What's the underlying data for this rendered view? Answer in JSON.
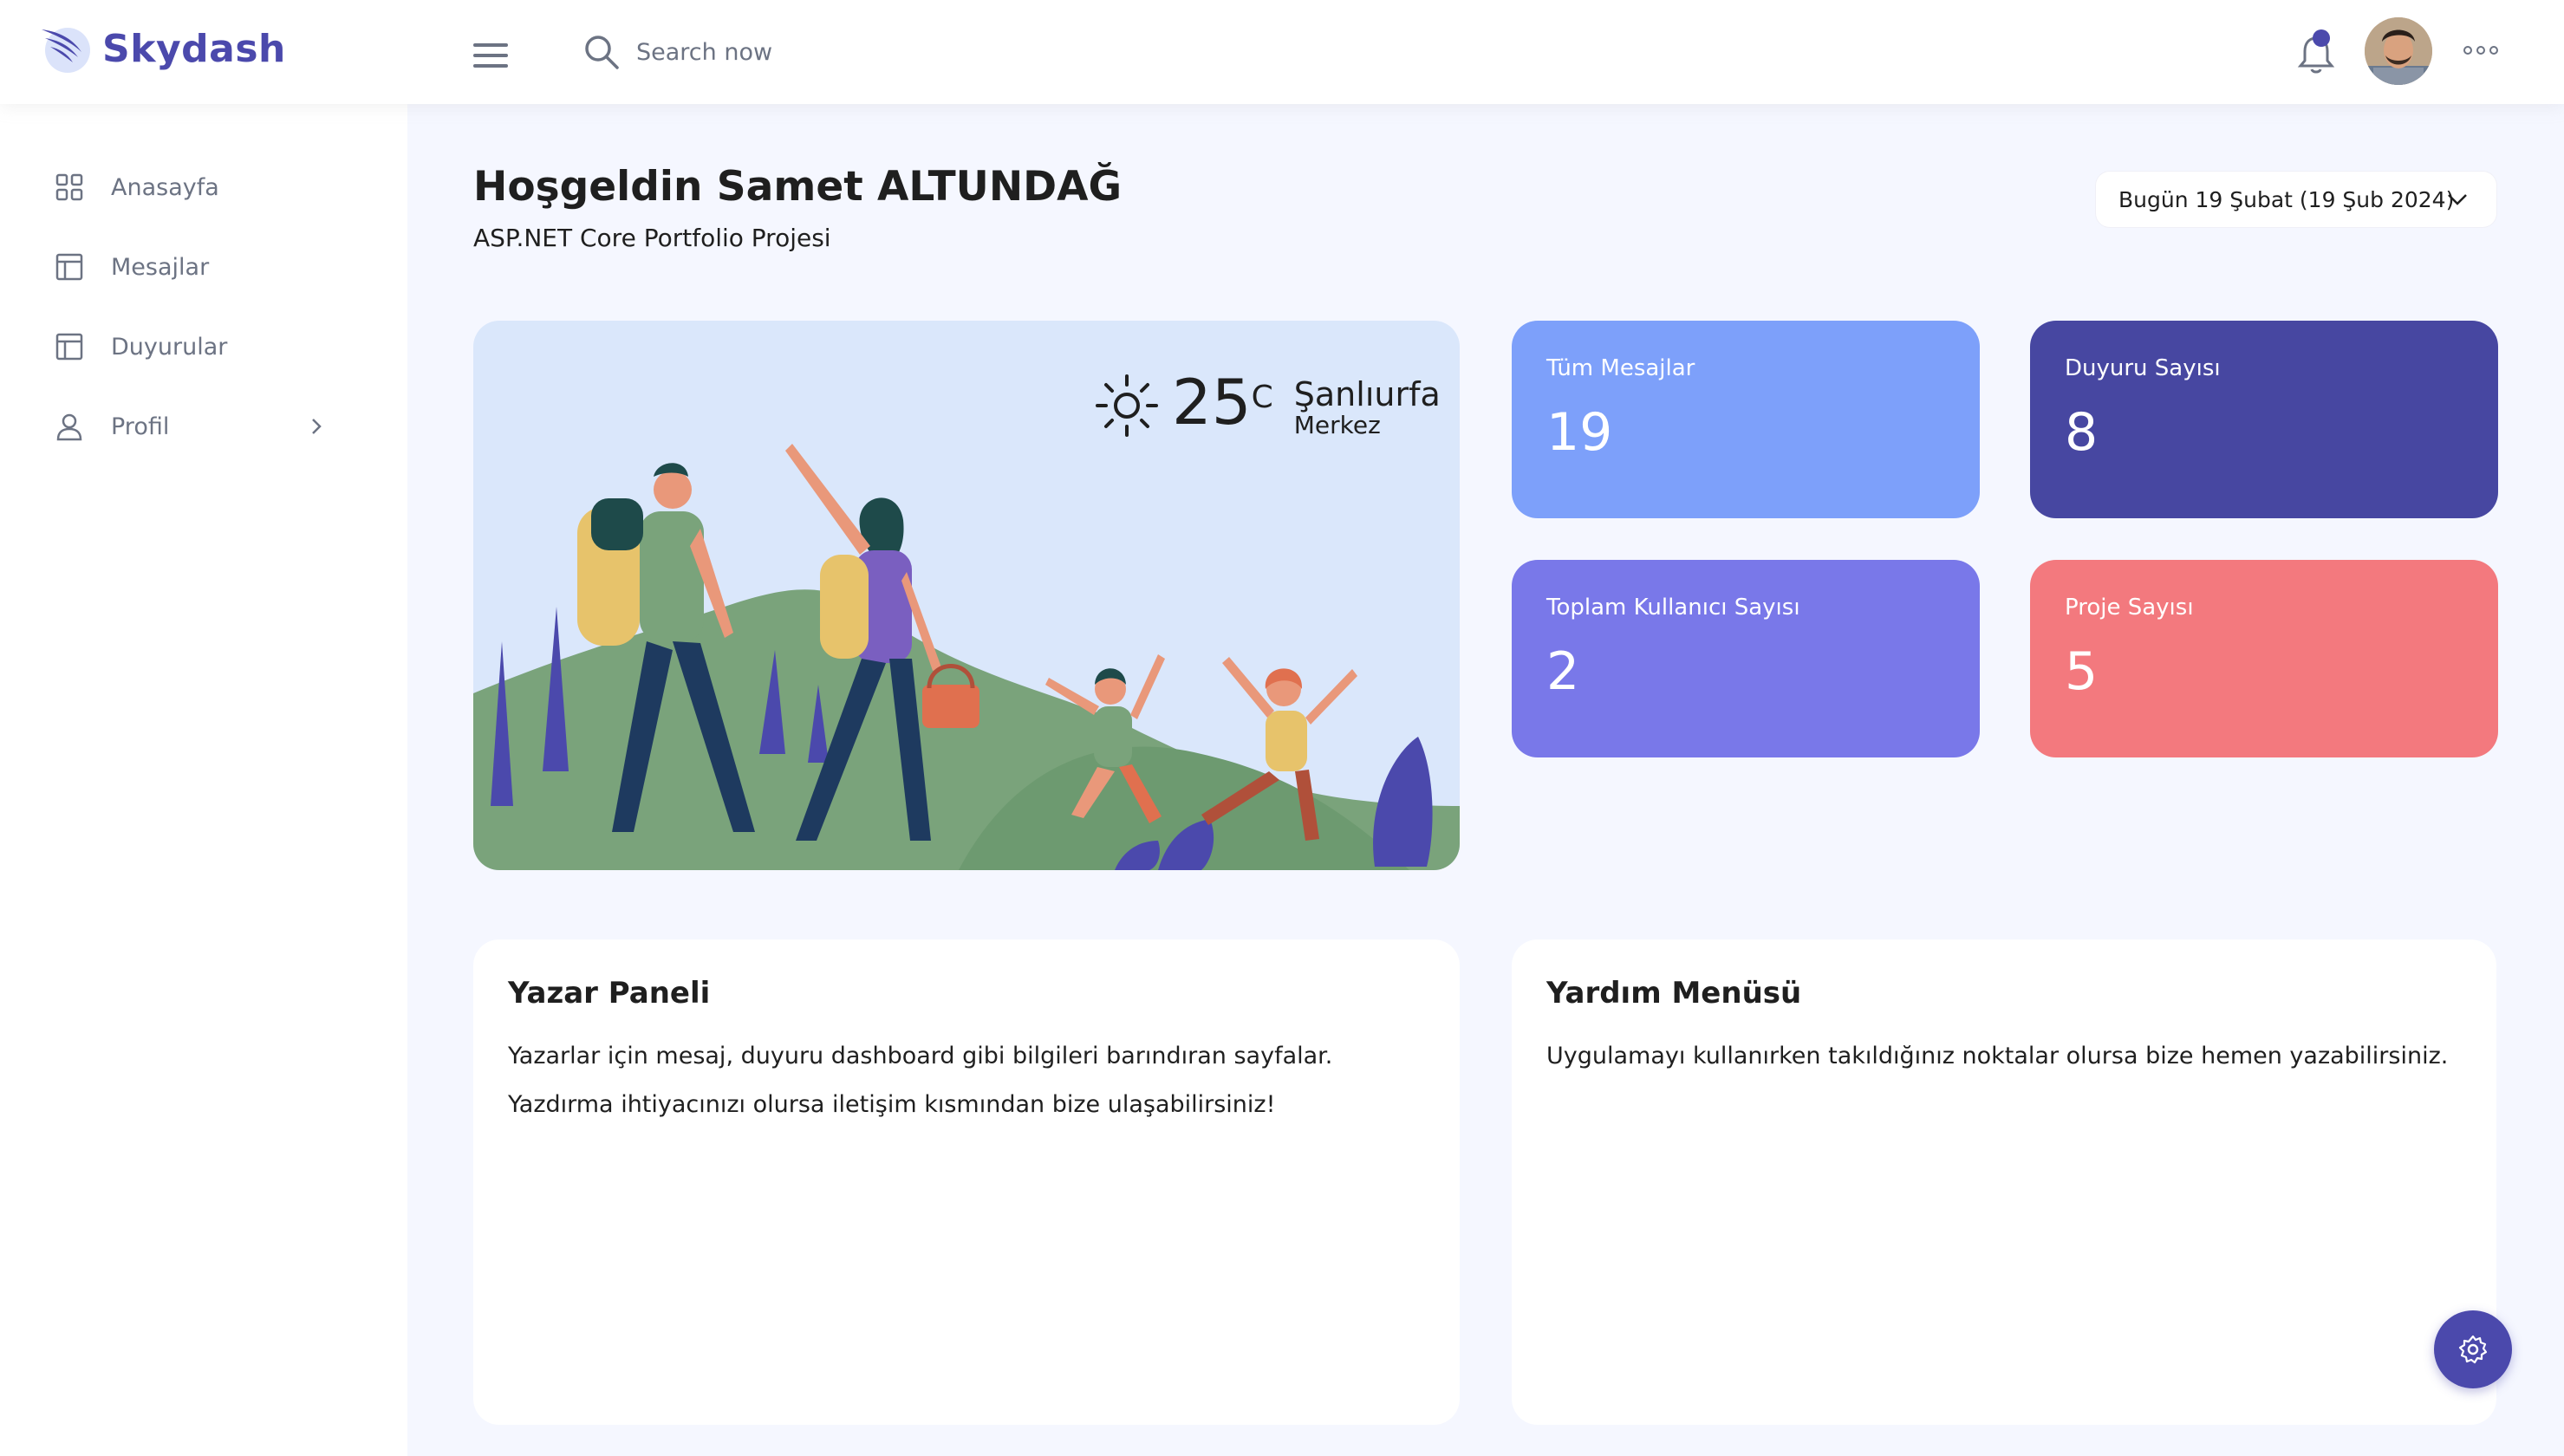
{
  "app": {
    "brand": "Skydash"
  },
  "search": {
    "placeholder": "Search now"
  },
  "sidebar": {
    "items": [
      {
        "label": "Anasayfa",
        "icon": "grid-icon"
      },
      {
        "label": "Mesajlar",
        "icon": "layout-icon"
      },
      {
        "label": "Duyurular",
        "icon": "layout-icon"
      },
      {
        "label": "Profil",
        "icon": "user-icon",
        "has_submenu": true
      }
    ]
  },
  "header": {
    "welcome": "Hoşgeldin Samet ALTUNDAĞ",
    "subtitle": "ASP.NET Core Portfolio Projesi",
    "date_label": "Bugün 19 Şubat (19 Şub 2024)"
  },
  "weather": {
    "temperature": "25",
    "unit": "C",
    "city": "Şanlıurfa",
    "district": "Merkez"
  },
  "stats": [
    {
      "title": "Tüm Mesajlar",
      "value": "19",
      "color": "#7da0fa"
    },
    {
      "title": "Duyuru Sayısı",
      "value": "8",
      "color": "#4747a1"
    },
    {
      "title": "Toplam Kullanıcı Sayısı",
      "value": "2",
      "color": "#7978e9"
    },
    {
      "title": "Proje Sayısı",
      "value": "5",
      "color": "#f3797e"
    }
  ],
  "panels": {
    "author": {
      "title": "Yazar Paneli",
      "line1": "Yazarlar için mesaj, duyuru dashboard gibi bilgileri barındıran sayfalar.",
      "line2": "Yazdırma ihtiyacınızı olursa iletişim kısmından bize ulaşabilirsiniz!"
    },
    "help": {
      "title": "Yardım Menüsü",
      "line1": "Uygulamayı kullanırken takıldığınız noktalar olursa bize hemen yazabilirsiniz."
    }
  },
  "colors": {
    "accent": "#4b49ac",
    "background": "#f5f7ff",
    "hero_bg": "#dae7fb"
  }
}
